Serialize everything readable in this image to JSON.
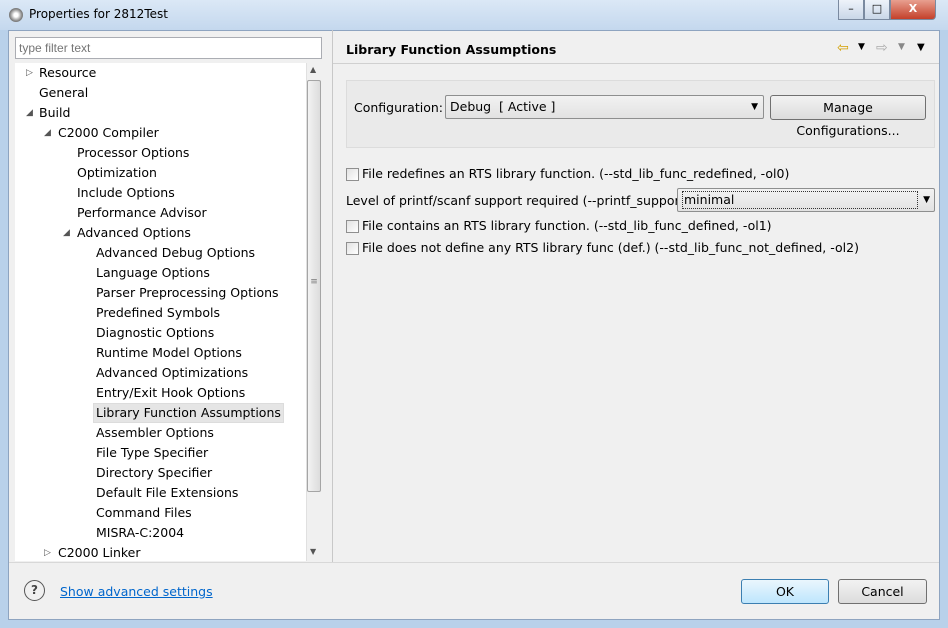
{
  "window": {
    "title": "Properties for 2812Test",
    "minimize": "–",
    "maximize": "□",
    "close": "X"
  },
  "filter": {
    "placeholder": "type filter text"
  },
  "tree": [
    {
      "label": "Resource",
      "level": 0,
      "arrow": "▷"
    },
    {
      "label": "General",
      "level": 0,
      "arrow": ""
    },
    {
      "label": "Build",
      "level": 0,
      "arrow": "◢"
    },
    {
      "label": "C2000 Compiler",
      "level": 1,
      "arrow": "◢"
    },
    {
      "label": "Processor Options",
      "level": 2,
      "arrow": ""
    },
    {
      "label": "Optimization",
      "level": 2,
      "arrow": ""
    },
    {
      "label": "Include Options",
      "level": 2,
      "arrow": ""
    },
    {
      "label": "Performance Advisor",
      "level": 2,
      "arrow": ""
    },
    {
      "label": "Advanced Options",
      "level": 2,
      "arrow": "◢"
    },
    {
      "label": "Advanced Debug Options",
      "level": 3,
      "arrow": ""
    },
    {
      "label": "Language Options",
      "level": 3,
      "arrow": ""
    },
    {
      "label": "Parser Preprocessing Options",
      "level": 3,
      "arrow": ""
    },
    {
      "label": "Predefined Symbols",
      "level": 3,
      "arrow": ""
    },
    {
      "label": "Diagnostic Options",
      "level": 3,
      "arrow": ""
    },
    {
      "label": "Runtime Model Options",
      "level": 3,
      "arrow": ""
    },
    {
      "label": "Advanced Optimizations",
      "level": 3,
      "arrow": ""
    },
    {
      "label": "Entry/Exit Hook Options",
      "level": 3,
      "arrow": ""
    },
    {
      "label": "Library Function Assumptions",
      "level": 3,
      "arrow": "",
      "selected": true
    },
    {
      "label": "Assembler Options",
      "level": 3,
      "arrow": ""
    },
    {
      "label": "File Type Specifier",
      "level": 3,
      "arrow": ""
    },
    {
      "label": "Directory Specifier",
      "level": 3,
      "arrow": ""
    },
    {
      "label": "Default File Extensions",
      "level": 3,
      "arrow": ""
    },
    {
      "label": "Command Files",
      "level": 3,
      "arrow": ""
    },
    {
      "label": "MISRA-C:2004",
      "level": 3,
      "arrow": ""
    },
    {
      "label": "C2000 Linker",
      "level": 1,
      "arrow": "▷"
    }
  ],
  "page": {
    "title": "Library Function Assumptions",
    "configuration_label": "Configuration:",
    "configuration_value": "Debug  [ Active ]",
    "manage_button": "Manage Configurations...",
    "options": {
      "redefined": {
        "label": "File redefines an RTS library function. (--std_lib_func_redefined, -ol0)",
        "checked": false
      },
      "printf_label": "Level of printf/scanf support required (--printf_support)",
      "printf_value": "minimal",
      "defined": {
        "label": "File contains an RTS library function. (--std_lib_func_defined, -ol1)",
        "checked": false
      },
      "not_defined": {
        "label": "File does not define any RTS library func (def.) (--std_lib_func_not_defined, -ol2)",
        "checked": false
      }
    }
  },
  "footer": {
    "help": "?",
    "advanced_link": "Show advanced settings",
    "ok": "OK",
    "cancel": "Cancel"
  }
}
